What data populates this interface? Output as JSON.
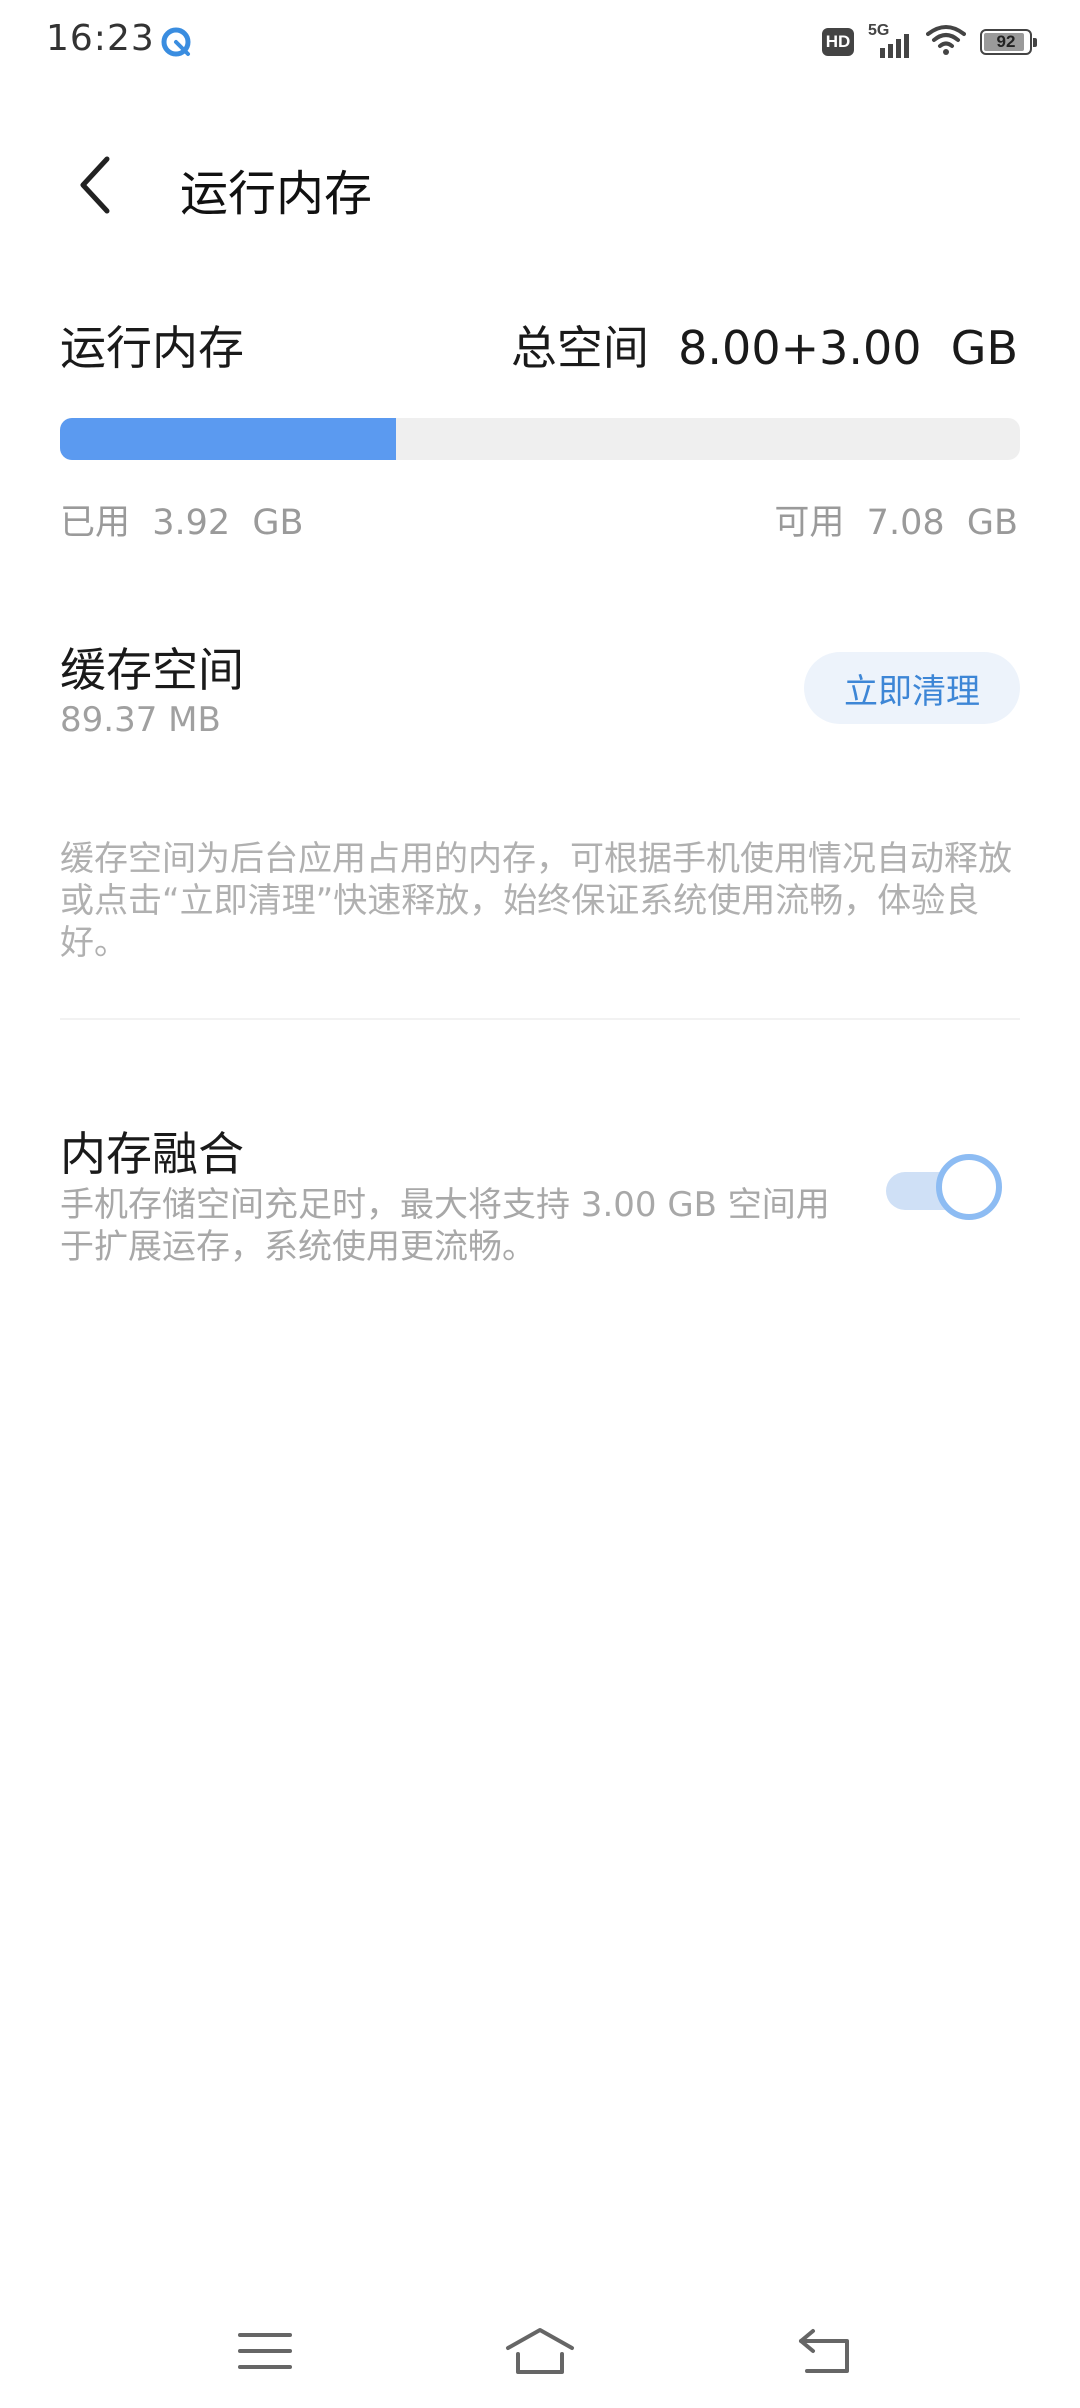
{
  "status_bar": {
    "time": "16:23",
    "hd": "HD",
    "network": "5G",
    "battery": "92",
    "battery_level_percent": 92
  },
  "header": {
    "title": "运行内存"
  },
  "memory": {
    "label": "运行内存",
    "total": "总空间  8.00+3.00  GB",
    "used": "已用  3.92  GB",
    "available": "可用  7.08  GB",
    "used_fraction": 0.35
  },
  "cache": {
    "title": "缓存空间",
    "size": "89.37 MB",
    "clean_button": "立即清理",
    "description": "缓存空间为后台应用占用的内存，可根据手机使用情况自动释放或点击“立即清理”快速释放，始终保证系统使用流畅，体验良好。"
  },
  "fusion": {
    "title": "内存融合",
    "description": "手机存储空间充足时，最大将支持 3.00 GB 空间用于扩展运存，系统使用更流畅。",
    "enabled": true
  },
  "colors": {
    "accent": "#5b9af0",
    "button_text": "#3d86d6",
    "secondary_text": "#9a9a9a"
  },
  "icons": {
    "back": "chevron-left-icon",
    "menu": "menu-icon",
    "home": "home-icon",
    "return": "return-icon"
  }
}
